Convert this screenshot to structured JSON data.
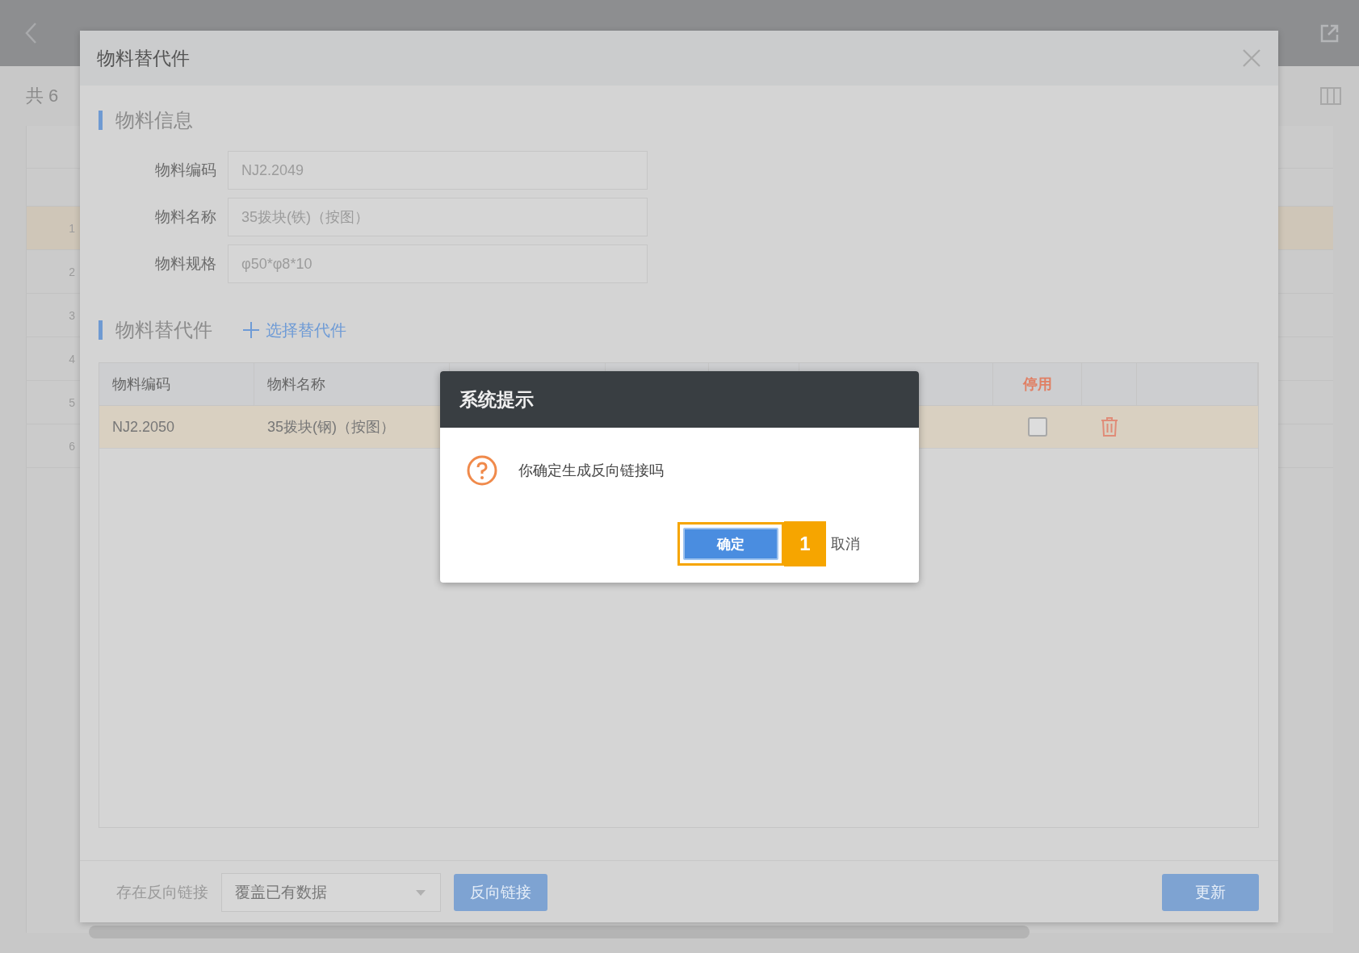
{
  "page": {
    "total_label": "共 6",
    "rows": [
      {
        "number": "1",
        "selected": true
      },
      {
        "number": "2",
        "selected": false
      },
      {
        "number": "3",
        "selected": false
      },
      {
        "number": "4",
        "selected": false
      },
      {
        "number": "5",
        "selected": false
      },
      {
        "number": "6",
        "selected": false
      }
    ]
  },
  "modal": {
    "title": "物料替代件",
    "info_title": "物料信息",
    "fields": [
      {
        "label": "物料编码",
        "value": "NJ2.2049"
      },
      {
        "label": "物料名称",
        "value": "35拨块(铁)（按图）"
      },
      {
        "label": "物料规格",
        "value": "φ50*φ8*10"
      }
    ],
    "replacements_title": "物料替代件",
    "add_link": "选择替代件",
    "columns": [
      {
        "label": "物料编码",
        "kind": "text"
      },
      {
        "label": "物料名称",
        "kind": "text"
      },
      {
        "kind": "blank"
      },
      {
        "kind": "blank"
      },
      {
        "kind": "blank"
      },
      {
        "kind": "blank"
      },
      {
        "label": "停用",
        "kind": "flag"
      },
      {
        "kind": "blank"
      }
    ],
    "rows": [
      {
        "code": "NJ2.2050",
        "name": "35拨块(钢)（按图）",
        "disabled": false,
        "selected": true
      }
    ],
    "footer": {
      "label": "存在反向链接",
      "select_value": "覆盖已有数据",
      "link_button": "反向链接",
      "update_button": "更新"
    }
  },
  "dialog": {
    "title": "系统提示",
    "message": "你确定生成反向链接吗",
    "ok": "确定",
    "cancel": "取消",
    "callout": "1"
  }
}
